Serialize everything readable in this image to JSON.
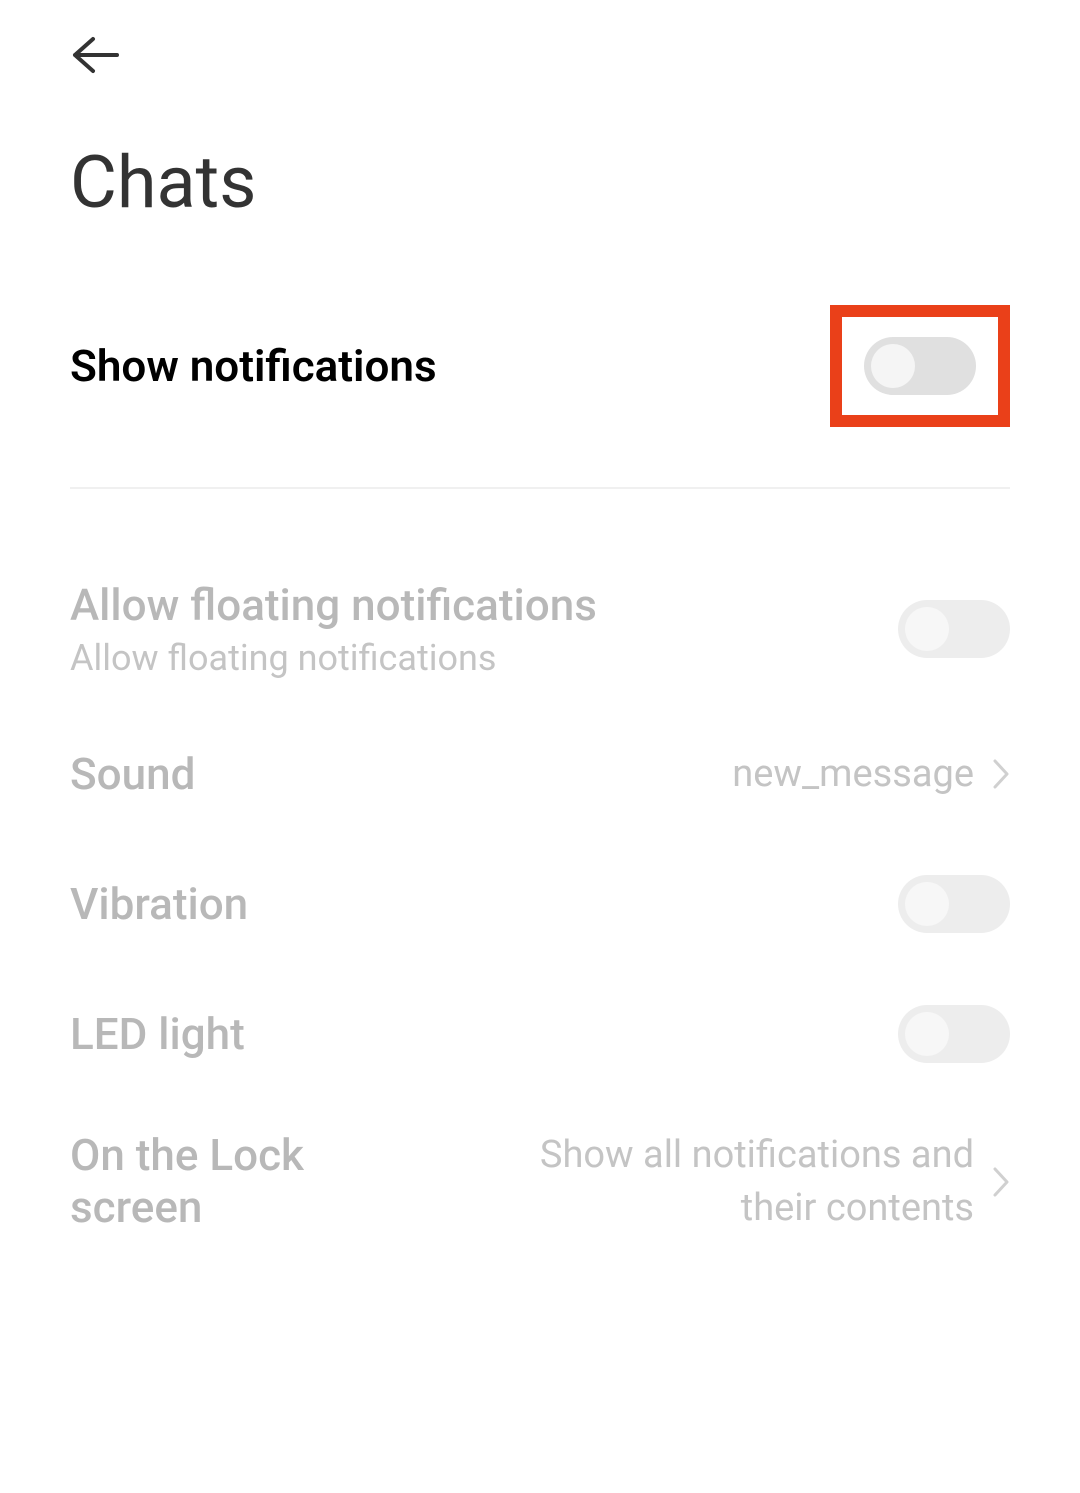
{
  "page": {
    "title": "Chats"
  },
  "settings": {
    "show_notifications": {
      "label": "Show notifications",
      "toggle_on": false
    },
    "floating": {
      "label": "Allow floating notifications",
      "sublabel": "Allow floating notifications",
      "toggle_on": false
    },
    "sound": {
      "label": "Sound",
      "value": "new_message"
    },
    "vibration": {
      "label": "Vibration",
      "toggle_on": false
    },
    "led": {
      "label": "LED light",
      "toggle_on": false
    },
    "lock_screen": {
      "label": "On the Lock screen",
      "value": "Show all notifications and their contents"
    }
  }
}
